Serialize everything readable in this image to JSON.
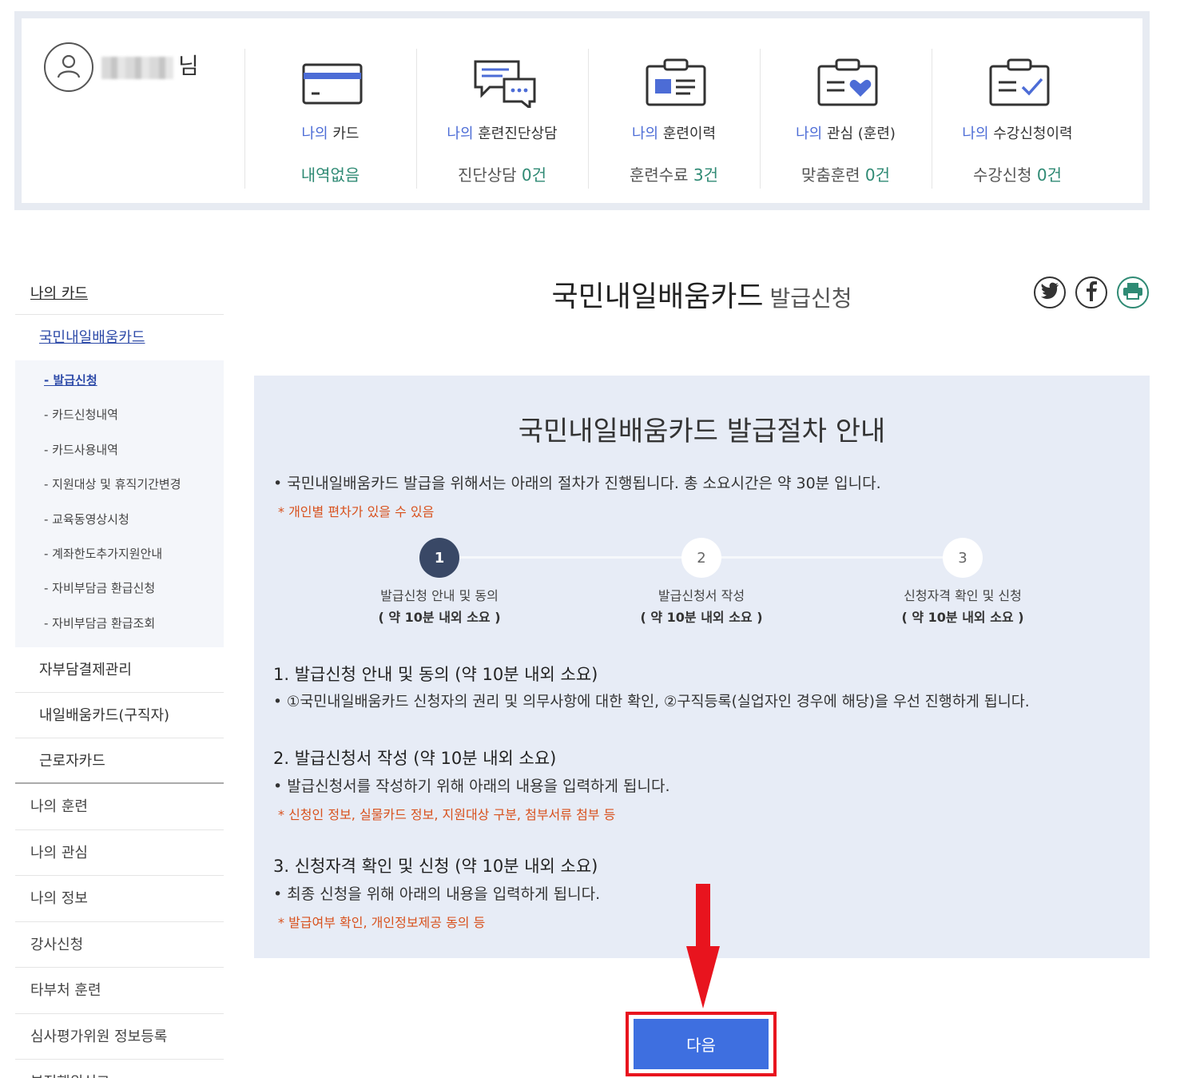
{
  "user": {
    "suffix": "님"
  },
  "stats": [
    {
      "prefix": "나의",
      "title": "카드",
      "value": "내역없음",
      "num": "",
      "icon": "credit-card-icon"
    },
    {
      "prefix": "나의",
      "title": "훈련진단상담",
      "value": "진단상담",
      "num": "0건",
      "icon": "chat-bubbles-icon"
    },
    {
      "prefix": "나의",
      "title": "훈련이력",
      "value": "훈련수료",
      "num": "3건",
      "icon": "clipboard-list-icon"
    },
    {
      "prefix": "나의",
      "title": "관심 (훈련)",
      "value": "맞춤훈련",
      "num": "0건",
      "icon": "clipboard-heart-icon"
    },
    {
      "prefix": "나의",
      "title": "수강신청이력",
      "value": "수강신청",
      "num": "0건",
      "icon": "clipboard-check-icon"
    }
  ],
  "sidebar": {
    "top": "나의 카드",
    "active_sub": "국민내일배움카드",
    "leaves": [
      "- 발급신청",
      "- 카드신청내역",
      "- 카드사용내역",
      "- 지원대상 및 휴직기간변경",
      "- 교육동영상시청",
      "- 계좌한도추가지원안내",
      "- 자비부담금 환급신청",
      "- 자비부담금 환급조회"
    ],
    "subs": [
      "자부담결제관리",
      "내일배움카드(구직자)",
      "근로자카드"
    ],
    "mains": [
      "나의 훈련",
      "나의 관심",
      "나의 정보",
      "강사신청",
      "타부처 훈련",
      "심사평가위원 정보등록",
      "부정행위신고"
    ]
  },
  "page": {
    "title_main": "국민내일배움카드",
    "title_sub": "발급신청"
  },
  "share": {
    "twitter": "twitter-icon",
    "facebook": "facebook-icon",
    "print": "print-icon"
  },
  "guide": {
    "title": "국민내일배움카드 발급절차 안내",
    "intro": "국민내일배움카드 발급을 위해서는 아래의 절차가 진행됩니다. 총 소요시간은 약 30분 입니다.",
    "intro_note": "* 개인별 편차가 있을 수 있음",
    "steps": [
      {
        "num": "1",
        "label": "발급신청 안내 및 동의",
        "time": "( 약 10분 내외 소요 )"
      },
      {
        "num": "2",
        "label": "발급신청서 작성",
        "time": "( 약 10분 내외 소요 )"
      },
      {
        "num": "3",
        "label": "신청자격 확인 및 신청",
        "time": "( 약 10분 내외 소요 )"
      }
    ],
    "sections": [
      {
        "head": "1. 발급신청 안내 및 동의 (약 10분 내외 소요)",
        "bullet": "①국민내일배움카드 신청자의 권리 및 의무사항에 대한 확인, ②구직등록(실업자인 경우에 해당)을 우선 진행하게 됩니다.",
        "note": ""
      },
      {
        "head": "2. 발급신청서 작성 (약 10분 내외 소요)",
        "bullet": "발급신청서를 작성하기 위해 아래의 내용을 입력하게 됩니다.",
        "note": "* 신청인 정보, 실물카드 정보, 지원대상 구분, 첨부서류 첨부 등"
      },
      {
        "head": "3. 신청자격 확인 및 신청 (약 10분 내외 소요)",
        "bullet": "최종 신청을 위해 아래의 내용을 입력하게 됩니다.",
        "note": "* 발급여부 확인, 개인정보제공 동의 등"
      }
    ]
  },
  "next_button": "다음",
  "colors": {
    "accent_blue": "#3e6fe0",
    "highlight_red": "#e8141e",
    "note_orange": "#d8511d",
    "count_green": "#2f8a74",
    "guide_bg": "#e7ecf6"
  }
}
